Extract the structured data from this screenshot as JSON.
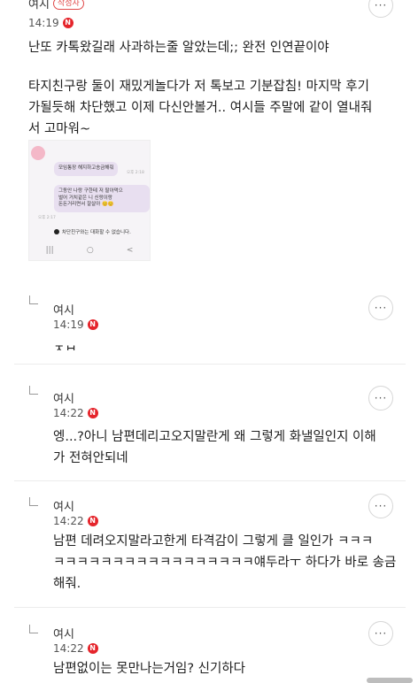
{
  "top_comment": {
    "author": "여시",
    "tag": "작성자",
    "time": "14:19",
    "badge": "N",
    "more_label": "···",
    "paragraph1": "난또 카톡왔길래 사과하는줄 알았는데;; 완전 인연끝이야",
    "paragraph2_line1": "타지친구랑 둘이 재밌게놀다가 저 톡보고 기분잡침! 마지막 후기",
    "paragraph2_line2": "가될듯해 차단했고 이제 다신안볼거.. 여시들 주말에 같이 열내줘",
    "paragraph2_line3": "서 고마워~",
    "attachment": {
      "bubble1": "모임통장 해지하고송금해줘",
      "bubble1_meta": "오후 2:18",
      "bubble2_line1": "그동안 나랑     구한테 저 팔아먹으",
      "bubble2_line2": "벌어 거치같은 니 신랑이랑",
      "bubble2_line3": "돈돈거리면서 잘살아 😊😊",
      "bubble2_meta": "오후 2:17",
      "warning": "차단친구와는 대화할 수 없습니다.",
      "nav_recent": "|||",
      "nav_home": "○",
      "nav_back": "<"
    }
  },
  "replies": [
    {
      "author": "여시",
      "time": "14:19",
      "badge": "N",
      "more_label": "···",
      "text_cut": "ㅈㅂ"
    },
    {
      "author": "여시",
      "time": "14:22",
      "badge": "N",
      "more_label": "···",
      "line1": "엥...?아니 남편데리고오지말란게 왜 그렇게 화낼일인지 이해",
      "line2": "가 전혀안되네"
    },
    {
      "author": "여시",
      "time": "14:22",
      "badge": "N",
      "more_label": "···",
      "line1": "남편 데려오지말라고한게 타격감이 그렇게 클 일인가 ㅋㅋㅋ",
      "line2": "ㅋㅋㅋㅋㅋㅋㅋㅋㅋㅋㅋㅋㅋㅋㅋㅋㅋ얘두라ㅜ 하다가 바로 송금",
      "line3": "해줘."
    },
    {
      "author": "여시",
      "time": "14:22",
      "badge": "N",
      "more_label": "···",
      "line1": "남편없이는 못만나는거임? 신기하다"
    }
  ]
}
